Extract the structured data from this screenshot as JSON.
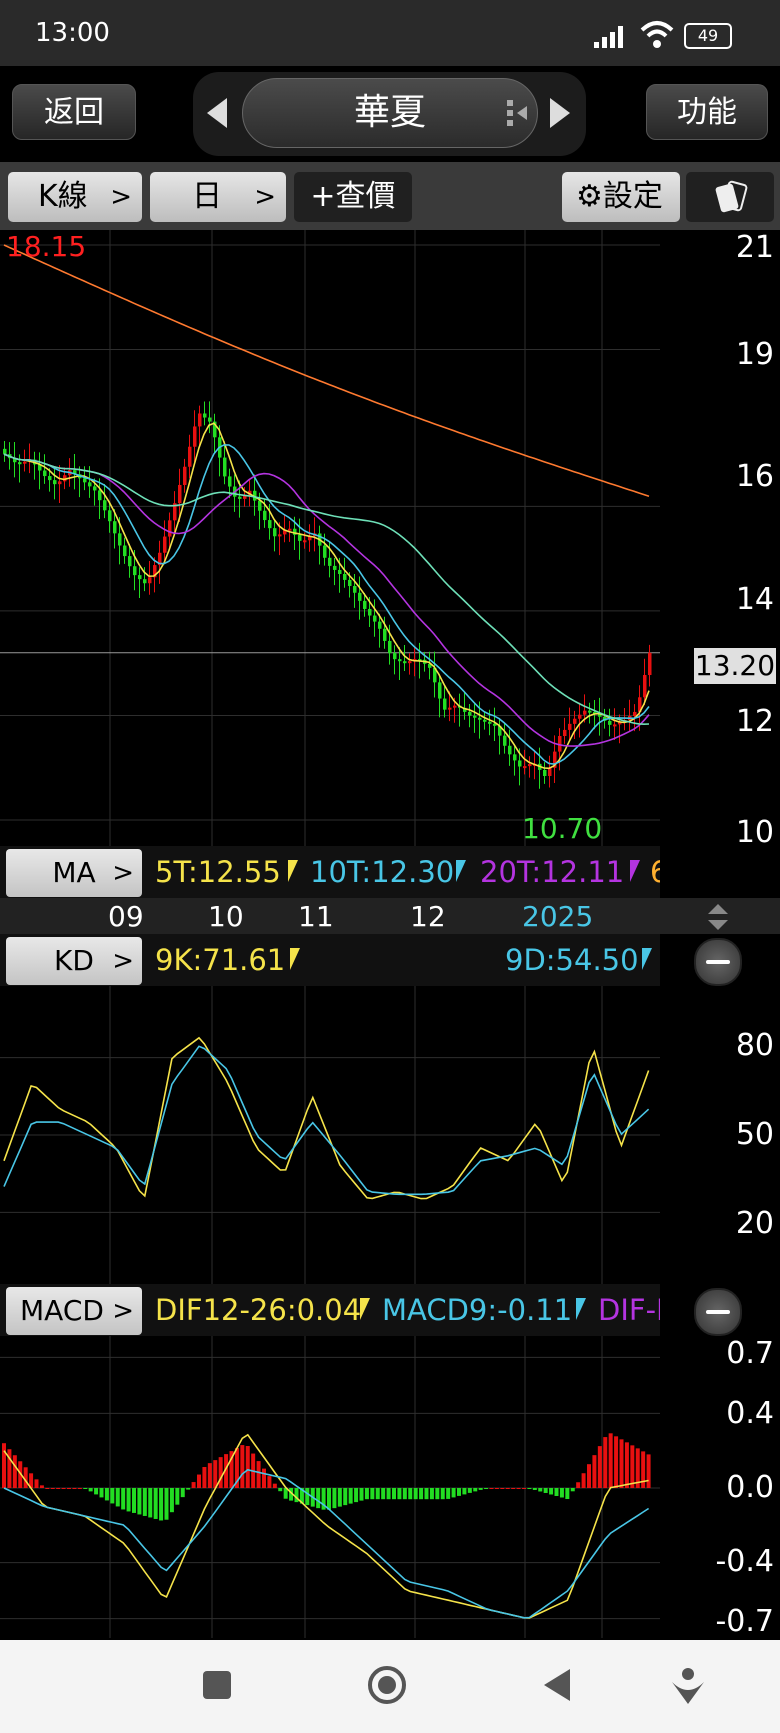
{
  "status": {
    "time": "13:00",
    "battery": "49"
  },
  "nav": {
    "back": "返回",
    "stock_name": "華夏",
    "func": "功能"
  },
  "toolbar": {
    "kline": "K線",
    "period": "日",
    "quote": "+查價",
    "settings": "設定"
  },
  "price_chart": {
    "high_label": "18.15",
    "low_label": "10.70",
    "current_price": "13.20",
    "y_ticks": [
      "21",
      "19",
      "16",
      "14",
      "12",
      "10"
    ],
    "x_ticks": [
      "09",
      "10",
      "11",
      "12",
      "2025"
    ]
  },
  "ma": {
    "button": "MA",
    "ma5": "5T:12.55",
    "ma10": "10T:12.30",
    "ma20": "20T:12.11",
    "ma_more": "6"
  },
  "kd": {
    "button": "KD",
    "k": "9K:71.61",
    "d": "9D:54.50",
    "y_ticks": [
      "80",
      "50",
      "20"
    ]
  },
  "macd": {
    "button": "MACD",
    "dif": "DIF12-26:0.04",
    "macd9": "MACD9:-0.11",
    "osc": "DIF-I",
    "y_ticks": [
      "0.7",
      "0.4",
      "0.0",
      "-0.4",
      "-0.7"
    ]
  },
  "colors": {
    "up": "#e81010",
    "down": "#22dd22",
    "ma5": "#f5e34a",
    "ma10": "#49c6e6",
    "ma20": "#b434e0",
    "ma60": "#6ee0b8",
    "ma240": "#ff7a30",
    "label_red": "#ff2020",
    "label_green": "#40e040"
  },
  "chart_data": {
    "type": "candlestick",
    "x": [
      "09",
      "10",
      "11",
      "12",
      "2025"
    ],
    "close": [
      17.0,
      16.8,
      16.9,
      16.6,
      16.4,
      16.7,
      16.5,
      16.3,
      15.8,
      15.2,
      14.7,
      14.5,
      15.1,
      15.9,
      16.8,
      17.8,
      17.6,
      16.6,
      16.1,
      16.3,
      15.8,
      15.4,
      15.6,
      15.3,
      15.5,
      14.9,
      14.7,
      14.4,
      14.0,
      13.7,
      13.1,
      13.0,
      13.1,
      12.9,
      12.1,
      12.2,
      12.0,
      11.9,
      11.8,
      11.3,
      11.0,
      11.1,
      10.8,
      11.6,
      11.9,
      12.1,
      12.0,
      11.8,
      11.9,
      12.1,
      13.2
    ],
    "ma240": [
      21.0,
      16.2
    ],
    "kd": {
      "k": [
        40,
        70,
        60,
        55,
        45,
        25,
        80,
        88,
        70,
        45,
        35,
        65,
        38,
        25,
        28,
        25,
        30,
        45,
        40,
        55,
        30,
        85,
        45,
        75
      ],
      "d": [
        30,
        55,
        55,
        50,
        45,
        30,
        70,
        85,
        75,
        50,
        40,
        55,
        42,
        28,
        27,
        27,
        28,
        40,
        42,
        45,
        38,
        75,
        50,
        60
      ]
    },
    "macd": {
      "dif": [
        0.2,
        -0.1,
        -0.15,
        -0.3,
        -0.6,
        -0.1,
        0.3,
        0.0,
        -0.2,
        -0.35,
        -0.55,
        -0.6,
        -0.65,
        -0.7,
        -0.6,
        0.0,
        0.04
      ],
      "macd9": [
        0.0,
        -0.1,
        -0.15,
        -0.2,
        -0.45,
        -0.2,
        0.1,
        0.05,
        -0.1,
        -0.3,
        -0.5,
        -0.55,
        -0.65,
        -0.7,
        -0.55,
        -0.25,
        -0.11
      ]
    }
  }
}
